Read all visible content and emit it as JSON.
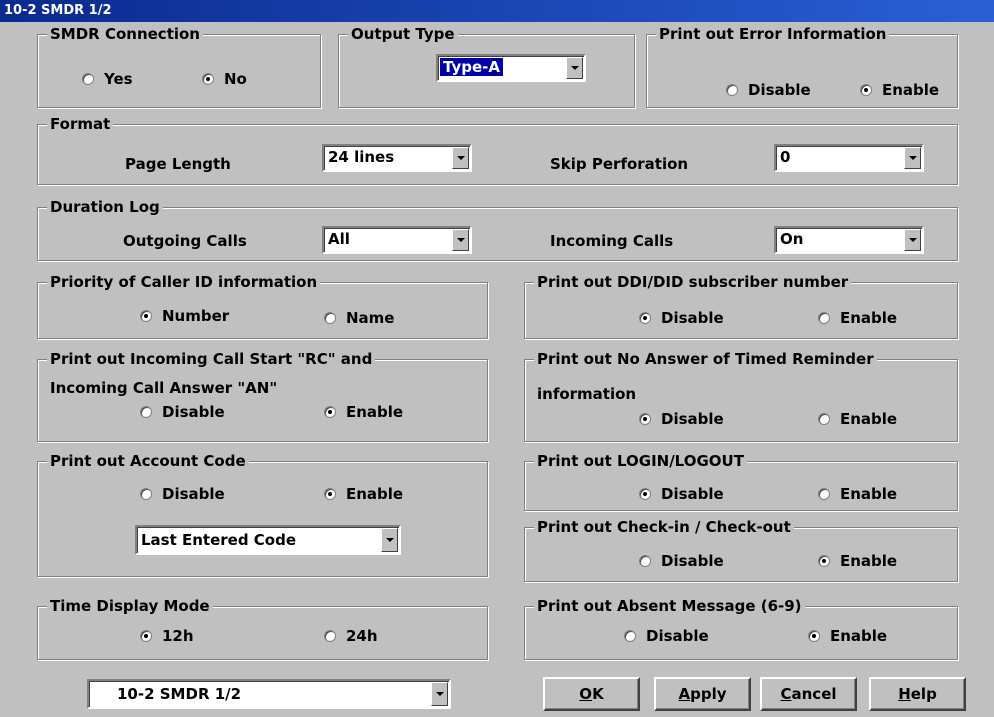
{
  "window": {
    "title": "10-2 SMDR 1/2"
  },
  "smdr_connection": {
    "legend": "SMDR Connection",
    "yes": "Yes",
    "no": "No",
    "selected": "No"
  },
  "output_type": {
    "legend": "Output Type",
    "value": "Type-A"
  },
  "error_info": {
    "legend": "Print out Error Information",
    "disable": "Disable",
    "enable": "Enable",
    "selected": "Enable"
  },
  "format": {
    "legend": "Format",
    "page_length_label": "Page Length",
    "page_length_value": "24 lines",
    "skip_perforation_label": "Skip Perforation",
    "skip_perforation_value": "0"
  },
  "duration_log": {
    "legend": "Duration Log",
    "outgoing_label": "Outgoing Calls",
    "outgoing_value": "All",
    "incoming_label": "Incoming Calls",
    "incoming_value": "On"
  },
  "caller_id": {
    "legend": "Priority of Caller ID information",
    "number": "Number",
    "name": "Name",
    "selected": "Number"
  },
  "ddi_did": {
    "legend": "Print out DDI/DID subscriber number",
    "disable": "Disable",
    "enable": "Enable",
    "selected": "Disable"
  },
  "incoming_rc_an": {
    "legend": "Print out Incoming Call Start \"RC\" and",
    "line2": "Incoming Call Answer \"AN\"",
    "disable": "Disable",
    "enable": "Enable",
    "selected": "Enable"
  },
  "no_answer_reminder": {
    "legend": "Print out No Answer of Timed Reminder",
    "line2": "information",
    "disable": "Disable",
    "enable": "Enable",
    "selected": "Disable"
  },
  "account_code": {
    "legend": "Print out Account Code",
    "disable": "Disable",
    "enable": "Enable",
    "selected": "Enable",
    "mode_value": "Last Entered Code"
  },
  "login_logout": {
    "legend": "Print out LOGIN/LOGOUT",
    "disable": "Disable",
    "enable": "Enable",
    "selected": "Disable"
  },
  "check_in_out": {
    "legend": "Print out Check-in / Check-out",
    "disable": "Disable",
    "enable": "Enable",
    "selected": "Enable"
  },
  "time_display": {
    "legend": "Time Display Mode",
    "h12": "12h",
    "h24": "24h",
    "selected": "12h"
  },
  "absent_message": {
    "legend": "Print out Absent Message (6-9)",
    "disable": "Disable",
    "enable": "Enable",
    "selected": "Enable"
  },
  "footer": {
    "page_select_value": "10-2 SMDR 1/2",
    "ok": {
      "mnemonic": "O",
      "rest": "K"
    },
    "apply": {
      "mnemonic": "A",
      "rest": "pply"
    },
    "cancel": {
      "mnemonic": "C",
      "rest": "ancel"
    },
    "help": {
      "mnemonic": "H",
      "rest": "elp"
    }
  },
  "icons": {
    "radio": "radio-button-icon",
    "dropdown": "chevron-down-icon"
  }
}
